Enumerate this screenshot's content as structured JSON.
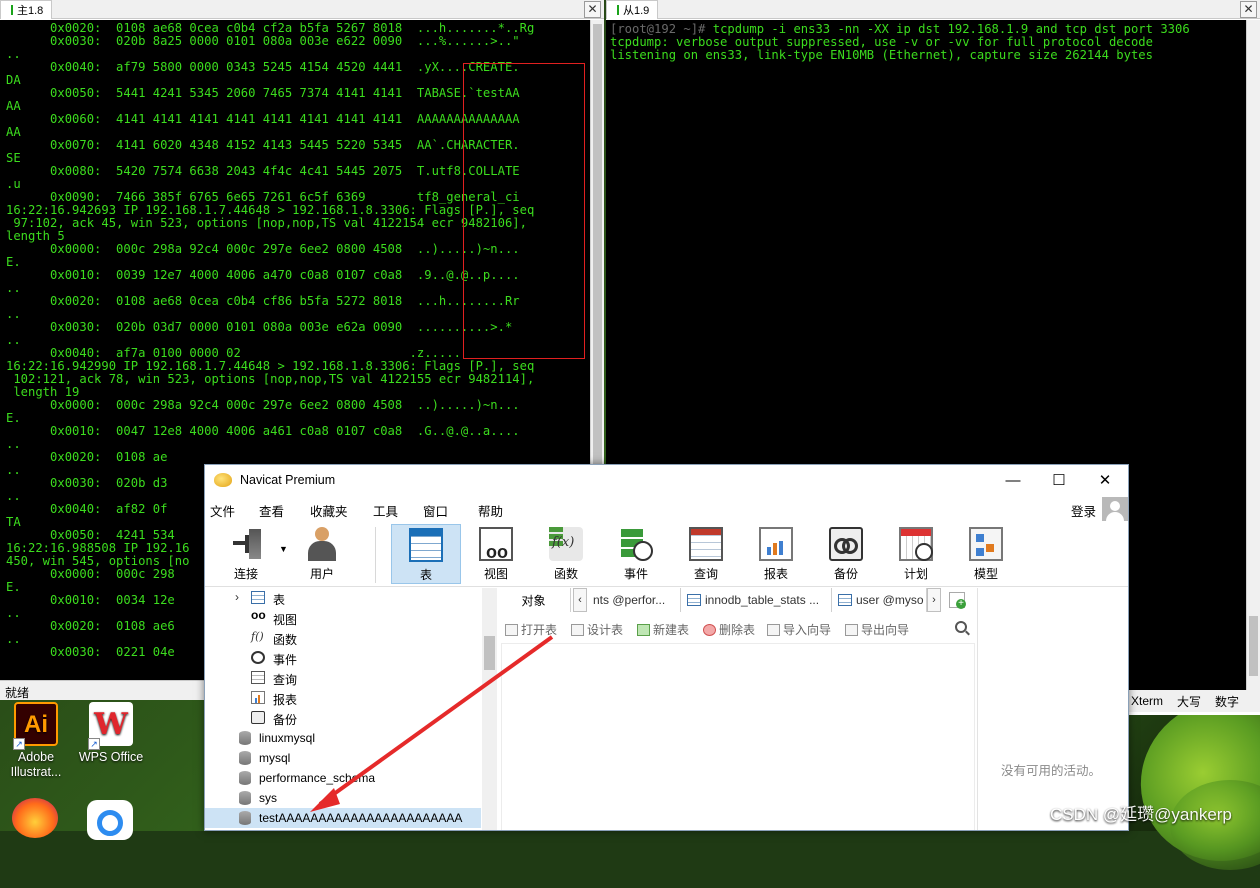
{
  "desktop": {
    "icons": [
      {
        "label_line1": "Adobe",
        "label_line2": "Illustrat...",
        "glyph": "Ai"
      },
      {
        "label_line1": "WPS Office",
        "label_line2": "",
        "glyph": "W"
      }
    ],
    "watermark": "CSDN @延瓒@yankerp"
  },
  "terminal_left": {
    "tab_label": "主1.8",
    "status": "就绪",
    "lines": [
      "      0x0020:  0108 ae68 0cea c0b4 cf2a b5fa 5267 8018  ...h.......*..Rg",
      "      0x0030:  020b 8a25 0000 0101 080a 003e e622 0090  ...%......>..\"",
      "..",
      "      0x0040:  af79 5800 0000 0343 5245 4154 4520 4441  .yX....CREATE.",
      "DA",
      "      0x0050:  5441 4241 5345 2060 7465 7374 4141 4141  TABASE.`testAA",
      "AA",
      "      0x0060:  4141 4141 4141 4141 4141 4141 4141 4141  AAAAAAAAAAAAAA",
      "AA",
      "      0x0070:  4141 6020 4348 4152 4143 5445 5220 5345  AA`.CHARACTER.",
      "SE",
      "      0x0080:  5420 7574 6638 2043 4f4c 4c41 5445 2075  T.utf8.COLLATE",
      ".u",
      "      0x0090:  7466 385f 6765 6e65 7261 6c5f 6369       tf8_general_ci",
      "16:22:16.942693 IP 192.168.1.7.44648 > 192.168.1.8.3306: Flags [P.], seq",
      " 97:102, ack 45, win 523, options [nop,nop,TS val 4122154 ecr 9482106],",
      "length 5",
      "      0x0000:  000c 298a 92c4 000c 297e 6ee2 0800 4508  ..).....)~n...",
      "E.",
      "      0x0010:  0039 12e7 4000 4006 a470 c0a8 0107 c0a8  .9..@.@..p....",
      "..",
      "      0x0020:  0108 ae68 0cea c0b4 cf86 b5fa 5272 8018  ...h........Rr",
      "..",
      "      0x0030:  020b 03d7 0000 0101 080a 003e e62a 0090  ..........>.*",
      "..",
      "      0x0040:  af7a 0100 0000 02                       .z.....",
      "16:22:16.942990 IP 192.168.1.7.44648 > 192.168.1.8.3306: Flags [P.], seq",
      " 102:121, ack 78, win 523, options [nop,nop,TS val 4122155 ecr 9482114],",
      " length 19",
      "      0x0000:  000c 298a 92c4 000c 297e 6ee2 0800 4508  ..).....)~n...",
      "E.",
      "      0x0010:  0047 12e8 4000 4006 a461 c0a8 0107 c0a8  .G..@.@..a....",
      "..",
      "      0x0020:  0108 ae",
      "..",
      "      0x0030:  020b d3",
      "..",
      "      0x0040:  af82 0f",
      "TA",
      "      0x0050:  4241 534",
      "16:22:16.988508 IP 192.16",
      "450, win 545, options [no",
      "      0x0000:  000c 298",
      "E.",
      "      0x0010:  0034 12e",
      "..",
      "      0x0020:  0108 ae6",
      "..",
      "      0x0030:  0221 04e"
    ]
  },
  "terminal_right": {
    "tab_label": "从1.9",
    "lines": [
      "[root@192 ~]# tcpdump -i ens33 -nn -XX ip dst 192.168.1.9 and tcp dst port 3306",
      "tcpdump: verbose output suppressed, use -v or -vv for full protocol decode",
      "listening on ens33, link-type EN10MB (Ethernet), capture size 262144 bytes"
    ],
    "status_items": [
      "Xterm",
      "大写",
      "数字"
    ]
  },
  "navicat": {
    "title": "Navicat Premium",
    "menu": [
      "文件",
      "查看",
      "收藏夹",
      "工具",
      "窗口",
      "帮助"
    ],
    "login": "登录",
    "toolbar": [
      "连接",
      "用户",
      "表",
      "视图",
      "函数",
      "事件",
      "查询",
      "报表",
      "备份",
      "计划",
      "模型"
    ],
    "tree": {
      "nodes": [
        "表",
        "视图",
        "函数",
        "事件",
        "查询",
        "报表",
        "备份"
      ],
      "databases": [
        "linuxmysql",
        "mysql",
        "performance_schema",
        "sys",
        "testAAAAAAAAAAAAAAAAAAAAAAA"
      ]
    },
    "object_tabs": {
      "first": "对象",
      "items": [
        "nts @perfor...",
        "innodb_table_stats ...",
        "user @myso"
      ]
    },
    "object_tools": [
      "打开表",
      "设计表",
      "新建表",
      "删除表",
      "导入向导",
      "导出向导"
    ],
    "info_empty": "没有可用的活动。"
  }
}
